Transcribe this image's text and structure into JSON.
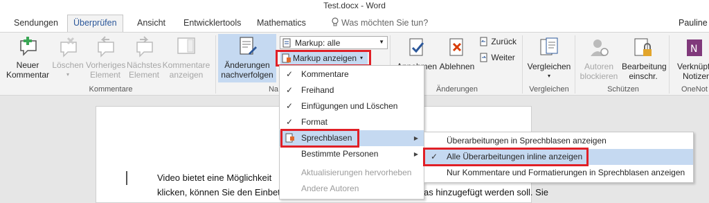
{
  "window": {
    "title": "Test.docx - Word"
  },
  "tabs": [
    "Sendungen",
    "Überprüfen",
    "Ansicht",
    "Entwicklertools",
    "Mathematics"
  ],
  "tell_me": "Was möchten Sie tun?",
  "user": "Pauline F",
  "ribbon": {
    "neuer_kommentar": [
      "Neuer",
      "Kommentar"
    ],
    "loeschen": "Löschen",
    "vorheriges": [
      "Vorheriges",
      "Element"
    ],
    "naechstes": [
      "Nächstes",
      "Element"
    ],
    "kommentare_anzeigen": [
      "Kommentare",
      "anzeigen"
    ],
    "group_kommentare": "Kommentare",
    "aenderungen_nachverfolgen": [
      "Änderungen",
      "nachverfolgen"
    ],
    "markup_select": "Markup: alle",
    "markup_anzeigen": "Markup anzeigen",
    "group_nachverfolgung": "Na",
    "annehmen": "Annehmen",
    "ablehnen": "Ablehnen",
    "zurueck": "Zurück",
    "weiter": "Weiter",
    "group_aenderungen": "Änderungen",
    "vergleichen": "Vergleichen",
    "group_vergleichen": "Vergleichen",
    "autoren_blockieren": [
      "Autoren",
      "blockieren"
    ],
    "bearbeitung_einschr": [
      "Bearbeitung",
      "einschr."
    ],
    "group_schuetzen": "Schützen",
    "verknuepf": [
      "Verknüpf",
      "Notizen"
    ],
    "group_onenote": "OneNot"
  },
  "markup_menu": [
    {
      "label": "Kommentare",
      "checked": true
    },
    {
      "label": "Freihand",
      "checked": true
    },
    {
      "label": "Einfügungen und Löschen",
      "checked": true
    },
    {
      "label": "Format",
      "checked": true
    },
    {
      "label": "Sprechblasen",
      "submenu": true
    },
    {
      "label": "Bestimmte Personen",
      "submenu": true
    },
    {
      "label": "Aktualisierungen hervorheben",
      "disabled": true
    },
    {
      "label": "Andere Autoren",
      "disabled": true
    }
  ],
  "sprechblasen_submenu": [
    {
      "label": "Überarbeitungen in Sprechblasen anzeigen"
    },
    {
      "label": "Alle Überarbeitungen inline anzeigen",
      "checked": true
    },
    {
      "label": "Nur Kommentare und Formatierungen in Sprechblasen anzeigen"
    }
  ],
  "document": {
    "line1": "Video bietet eine Möglichkeit",
    "line2a": "klicken, können Sie den Einbet",
    "line2b": "as hinzugefügt werden soll. Sie"
  },
  "colors": {
    "accent": "#2b579a",
    "highlight": "#c5d9f1",
    "callout": "#e01f26"
  },
  "check_glyph": "✓"
}
